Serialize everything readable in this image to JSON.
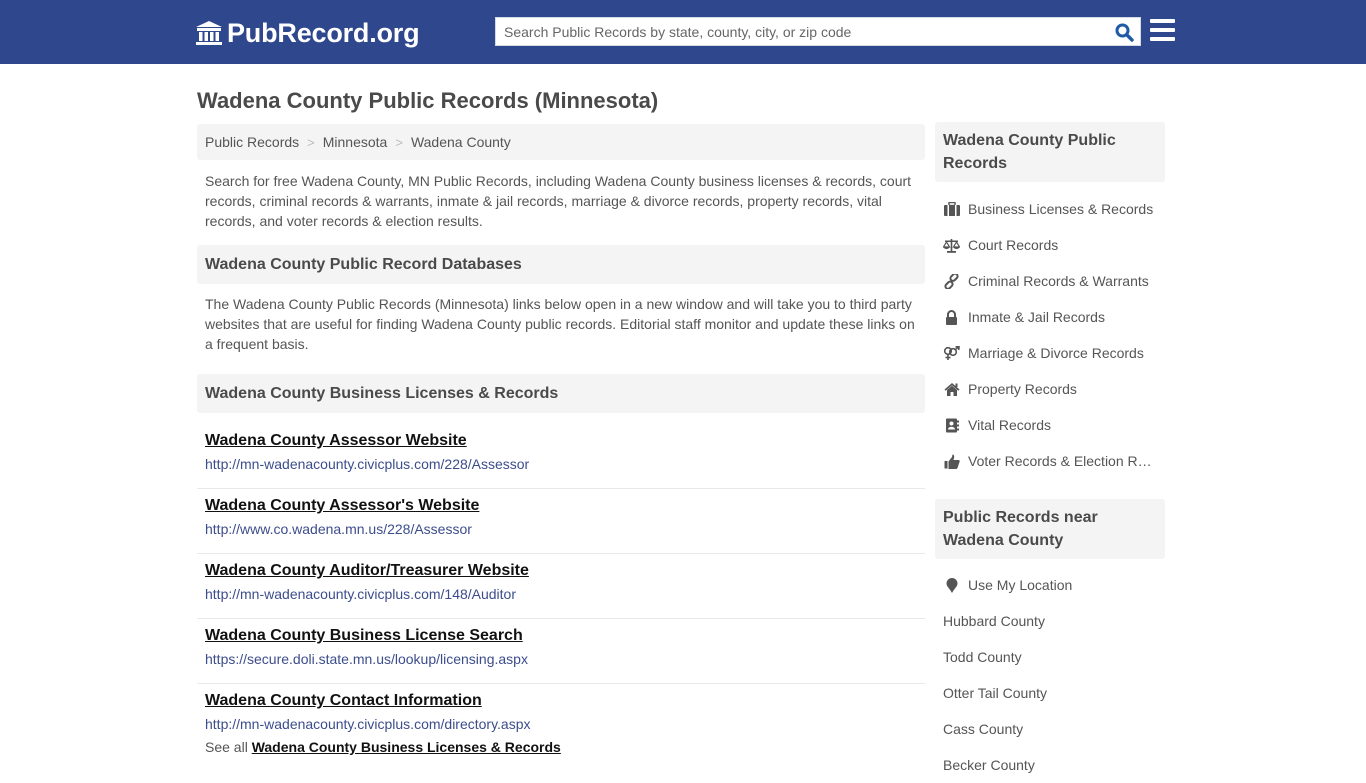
{
  "header": {
    "logo_text": "PubRecord.org",
    "logo_icon": "courthouse-icon",
    "search_placeholder": "Search Public Records by state, county, city, or zip code",
    "search_value": "",
    "brand_color": "#2e478d"
  },
  "page": {
    "title": "Wadena County Public Records (Minnesota)"
  },
  "breadcrumb": [
    {
      "label": "Public Records"
    },
    {
      "label": "Minnesota"
    },
    {
      "label": "Wadena County"
    }
  ],
  "breadcrumb_separator": ">",
  "intro": "Search for free Wadena County, MN Public Records, including Wadena County business licenses & records, court records, criminal records & warrants, inmate & jail records, marriage & divorce records, property records, vital records, and voter records & election results.",
  "databases": {
    "heading": "Wadena County Public Record Databases",
    "note": "The Wadena County Public Records (Minnesota) links below open in a new window and will take you to third party websites that are useful for finding Wadena County public records. Editorial staff monitor and update these links on a frequent basis."
  },
  "business_section": {
    "heading": "Wadena County Business Licenses & Records",
    "links": [
      {
        "title": "Wadena County Assessor Website",
        "url": "http://mn-wadenacounty.civicplus.com/228/Assessor"
      },
      {
        "title": "Wadena County Assessor's Website",
        "url": "http://www.co.wadena.mn.us/228/Assessor"
      },
      {
        "title": "Wadena County Auditor/Treasurer Website",
        "url": "http://mn-wadenacounty.civicplus.com/148/Auditor"
      },
      {
        "title": "Wadena County Business License Search",
        "url": "https://secure.doli.state.mn.us/lookup/licensing.aspx"
      },
      {
        "title": "Wadena County Contact Information",
        "url": "http://mn-wadenacounty.civicplus.com/directory.aspx"
      }
    ],
    "see_all_prefix": "See all",
    "see_all_link": "Wadena County Business Licenses & Records"
  },
  "sidebar": {
    "records_heading": "Wadena County Public Records",
    "records": [
      {
        "label": "Business Licenses & Records",
        "icon": "briefcase-icon"
      },
      {
        "label": "Court Records",
        "icon": "balance-scale-icon"
      },
      {
        "label": "Criminal Records & Warrants",
        "icon": "link-icon"
      },
      {
        "label": "Inmate & Jail Records",
        "icon": "lock-icon"
      },
      {
        "label": "Marriage & Divorce Records",
        "icon": "gender-symbols-icon"
      },
      {
        "label": "Property Records",
        "icon": "home-icon"
      },
      {
        "label": "Vital Records",
        "icon": "address-book-icon"
      },
      {
        "label": "Voter Records & Election Results",
        "icon": "thumbs-up-icon"
      }
    ],
    "near_heading": "Public Records near Wadena County",
    "use_location": "Use My Location",
    "nearby": [
      {
        "label": "Hubbard County"
      },
      {
        "label": "Todd County"
      },
      {
        "label": "Otter Tail County"
      },
      {
        "label": "Cass County"
      },
      {
        "label": "Becker County"
      }
    ]
  }
}
